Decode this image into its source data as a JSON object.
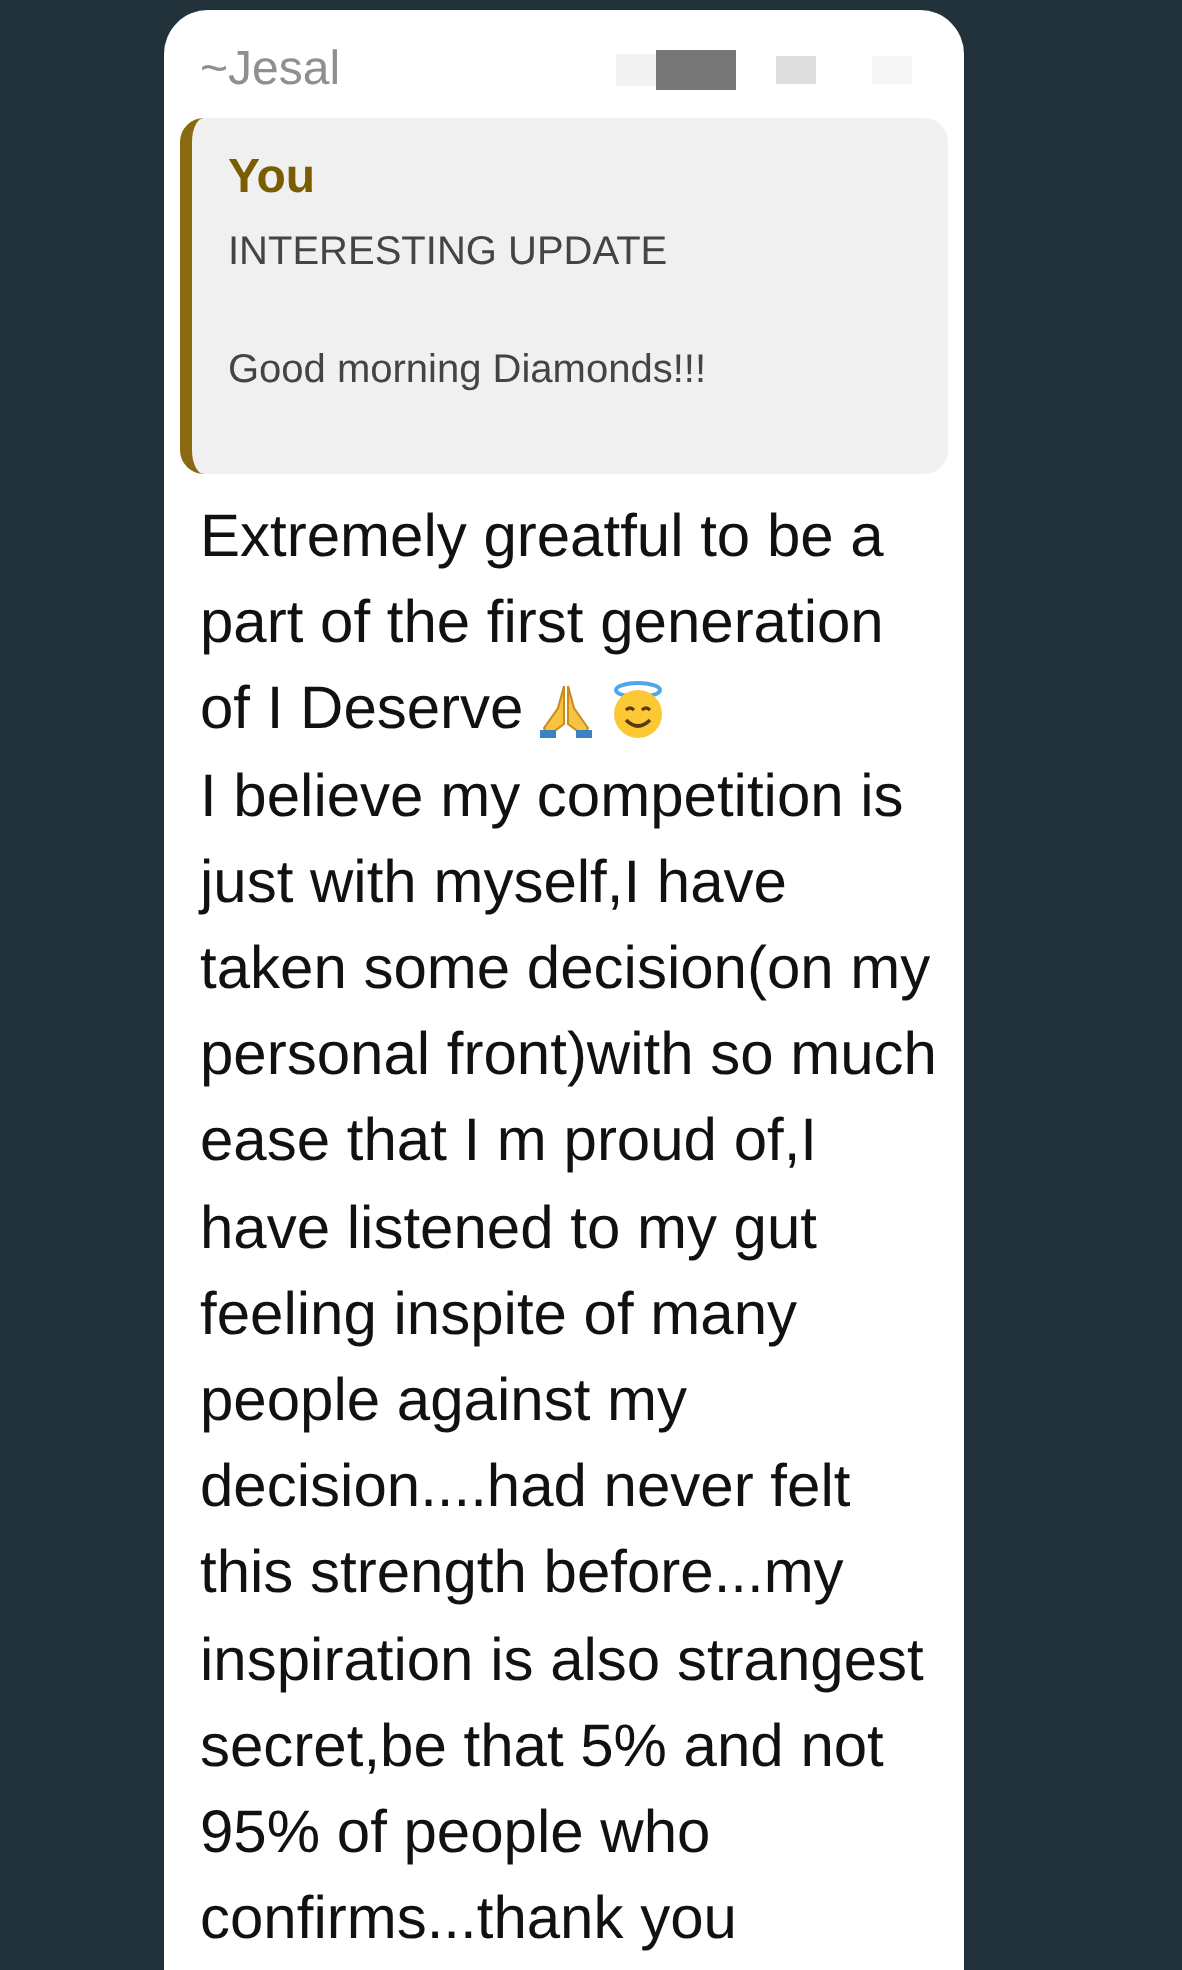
{
  "message": {
    "sender": "~Jesal",
    "quote": {
      "author": "You",
      "title": "INTERESTING UPDATE",
      "text": "Good morning Diamonds!!!"
    },
    "paragraphs": [
      "Extremely greatful to be a part of the first generation",
      "of I Deserve",
      "I believe my competition is just with myself,I have taken some decision(on my personal front)with so much ease that I m proud of,I have listened to my gut feeling inspite of many people against my decision....had never felt this strength before...my inspiration is also strangest secret,be that 5% and not 95% of people who confirms...thank you"
    ]
  }
}
